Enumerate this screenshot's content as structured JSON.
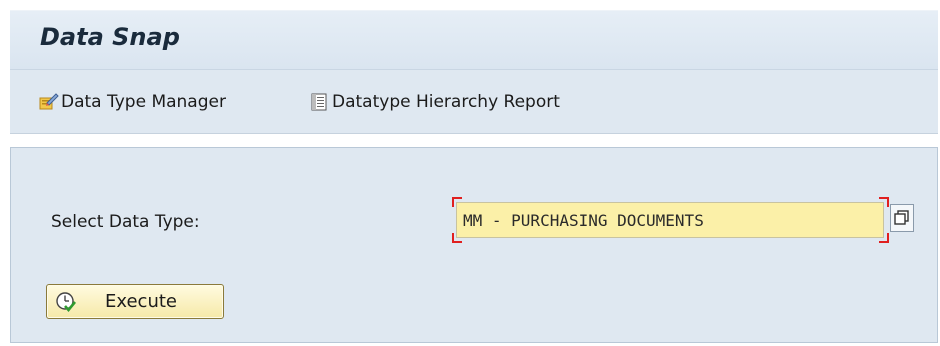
{
  "window": {
    "title": "Data Snap"
  },
  "toolbar": {
    "data_type_manager_label": "Data Type Manager",
    "data_type_manager_icon": "pencil-edit-icon",
    "hierarchy_report_label": "Datatype Hierarchy Report",
    "hierarchy_report_icon": "report-list-icon"
  },
  "form": {
    "select_data_type_label": "Select Data Type:",
    "select_data_type_value": "MM - PURCHASING DOCUMENTS",
    "value_help_icon": "value-help-icon",
    "execute_label": "Execute",
    "execute_icon": "execute-clock-check-icon"
  },
  "colors": {
    "header_bg": "#dae5f0",
    "panel_bg": "#dfe8f1",
    "input_bg": "#fbf0a8",
    "required_marker": "#e02020",
    "button_bg": "#f6e9a8"
  }
}
